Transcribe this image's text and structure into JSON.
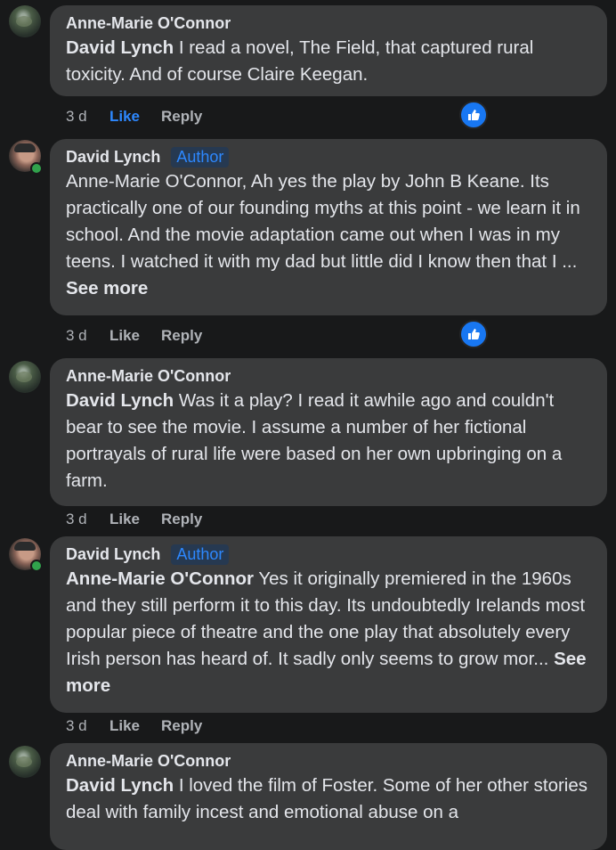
{
  "comments": [
    {
      "author": "Anne-Marie O'Connor",
      "mention": "David Lynch",
      "text": " I read a novel, The Field, that captured rural toxicity. And of course Claire Keegan.",
      "time": "3 d",
      "like": "Like",
      "reply": "Reply"
    },
    {
      "author": "David Lynch",
      "badge": "Author",
      "text": "Anne-Marie O'Connor, Ah yes the play by John B Keane. Its practically one of our founding myths at this point - we learn it in school. And the movie adaptation came out when I was in my teens. I watched it with my dad but little did I know then that I ... ",
      "see_more": "See more",
      "time": "3 d",
      "like": "Like",
      "reply": "Reply"
    },
    {
      "author": "Anne-Marie O'Connor",
      "mention": "David Lynch",
      "text": " Was it a play? I read it awhile ago and couldn't bear to see the movie. I assume a number of her fictional portrayals of rural life were based on her own upbringing on a farm.",
      "time": "3 d",
      "like": "Like",
      "reply": "Reply"
    },
    {
      "author": "David Lynch",
      "badge": "Author",
      "mention": "Anne-Marie O'Connor",
      "text": " Yes it originally premiered in the 1960s and they still perform it to this day. Its undoubtedly Irelands most popular piece of theatre and the one play that absolutely every Irish person has heard of. It sadly only seems to grow mor... ",
      "see_more": "See more",
      "time": "3 d",
      "like": "Like",
      "reply": "Reply"
    },
    {
      "author": "Anne-Marie O'Connor",
      "mention": "David Lynch",
      "text": " I loved the film of Foster. Some of her other stories deal with family incest and emotional abuse on a"
    }
  ],
  "colors": {
    "background": "#18191a",
    "bubble": "#3a3b3c",
    "accent": "#2d88ff",
    "like_active": "#2d88ff",
    "online": "#31a24c",
    "muted": "#b0b3b8"
  },
  "icons": {
    "reaction": "thumbs-up-icon",
    "online": "online-status-dot"
  }
}
